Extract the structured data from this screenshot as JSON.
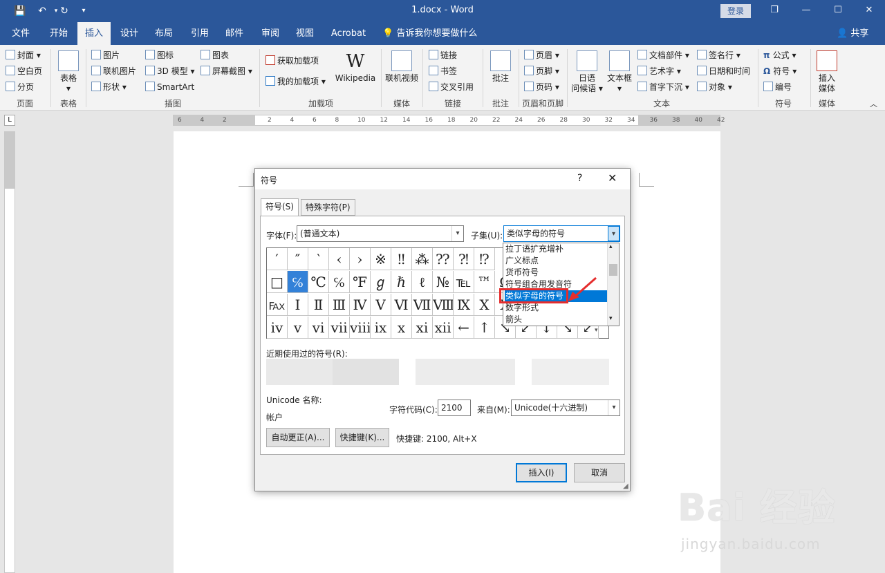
{
  "titlebar": {
    "doc_title": "1.docx - Word",
    "login": "登录",
    "restore": "❐",
    "minimize": "—",
    "maximize": "☐",
    "close": "✕"
  },
  "tabs": {
    "file": "文件",
    "home": "开始",
    "insert": "插入",
    "design": "设计",
    "layout": "布局",
    "references": "引用",
    "mailings": "邮件",
    "review": "审阅",
    "view": "视图",
    "acrobat": "Acrobat",
    "tellme": "告诉我你想要做什么",
    "share": "共享"
  },
  "ribbon": {
    "cover": "封面",
    "blank_page": "空白页",
    "page_break": "分页",
    "group_pages": "页面",
    "table": "表格",
    "group_table": "表格",
    "pictures": "图片",
    "online_pictures": "联机图片",
    "shapes": "形状",
    "icons": "图标",
    "model_3d": "3D 模型",
    "smartart": "SmartArt",
    "chart": "图表",
    "screenshot": "屏幕截图",
    "group_illustrations": "插图",
    "get_addins": "获取加载项",
    "my_addins": "我的加载项",
    "wikipedia": "Wikipedia",
    "group_addins": "加载项",
    "online_video": "联机视频",
    "group_media": "媒体",
    "link": "链接",
    "bookmark": "书签",
    "cross_ref": "交叉引用",
    "group_links": "链接",
    "comment": "批注",
    "group_comments": "批注",
    "header": "页眉",
    "footer": "页脚",
    "page_number": "页码",
    "group_header_footer": "页眉和页脚",
    "japanese_1": "日语",
    "japanese_2": "问候语",
    "textbox_1": "文本框",
    "quick_parts": "文档部件",
    "wordart": "艺术字",
    "dropcap": "首字下沉",
    "signature": "签名行",
    "datetime": "日期和时间",
    "object": "对象",
    "group_text": "文本",
    "equation": "公式",
    "symbol": "符号",
    "number": "编号",
    "group_symbols": "符号",
    "insert_media_1": "插入",
    "insert_media_2": "媒体",
    "group_media2": "媒体"
  },
  "dialog": {
    "title": "符号",
    "help": "?",
    "close": "✕",
    "tab_symbols": "符号(S)",
    "tab_special": "特殊字符(P)",
    "font_label": "字体(F):",
    "font_value": "(普通文本)",
    "subset_label": "子集(U):",
    "subset_value": "类似字母的符号",
    "subset_options": [
      "拉丁语扩充增补",
      "广义标点",
      "货币符号",
      "符号组合用发音符",
      "类似字母的符号",
      "数字形式",
      "箭头"
    ],
    "symbols_rows": [
      [
        "′",
        "″",
        "‵",
        "‹",
        "›",
        "※",
        "‼",
        "⁂",
        "⁇",
        "⁈",
        "⁉"
      ],
      [
        "□",
        "℅",
        "℃",
        "℅",
        "℉",
        "ℊ",
        "ℏ",
        "ℓ",
        "№",
        "℡",
        "™"
      ],
      [
        "℻",
        "Ⅰ",
        "Ⅱ",
        "Ⅲ",
        "Ⅳ",
        "Ⅴ",
        "Ⅵ",
        "Ⅶ",
        "Ⅷ",
        "Ⅸ",
        "Ⅹ"
      ],
      [
        "ⅳ",
        "ⅴ",
        "ⅵ",
        "ⅶ",
        "ⅷ",
        "ⅸ",
        "ⅹ",
        "ⅺ",
        "ⅻ",
        "←",
        "↑"
      ]
    ],
    "symbols_tail_rows": [
      [
        "Ω"
      ],
      [
        "Ⅹ"
      ],
      [
        "↘",
        "↙",
        "↕",
        "↘",
        "↙"
      ]
    ],
    "recent_label": "近期使用过的符号(R):",
    "unicode_name_label": "Unicode 名称:",
    "unicode_name_value": "帐户",
    "char_code_label": "字符代码(C):",
    "char_code_value": "2100",
    "from_label": "来自(M):",
    "from_value": "Unicode(十六进制)",
    "autocorrect": "自动更正(A)...",
    "shortcut_btn": "快捷键(K)...",
    "shortcut_text": "快捷键: 2100, Alt+X",
    "insert": "插入(I)",
    "cancel": "取消"
  },
  "ruler": {
    "h_ticks": [
      "6",
      "4",
      "2",
      "",
      "2",
      "4",
      "6",
      "8",
      "10",
      "12",
      "14",
      "16",
      "18",
      "20",
      "22",
      "24",
      "26",
      "28",
      "30",
      "32",
      "34",
      "36",
      "38",
      "40",
      "42"
    ],
    "corner": "L"
  },
  "watermark": {
    "main": "Bai 经验",
    "sub": "jingyan.baidu.com"
  },
  "colors": {
    "accent": "#2b579a",
    "selection": "#0078d7",
    "highlight": "#e52d2d"
  }
}
